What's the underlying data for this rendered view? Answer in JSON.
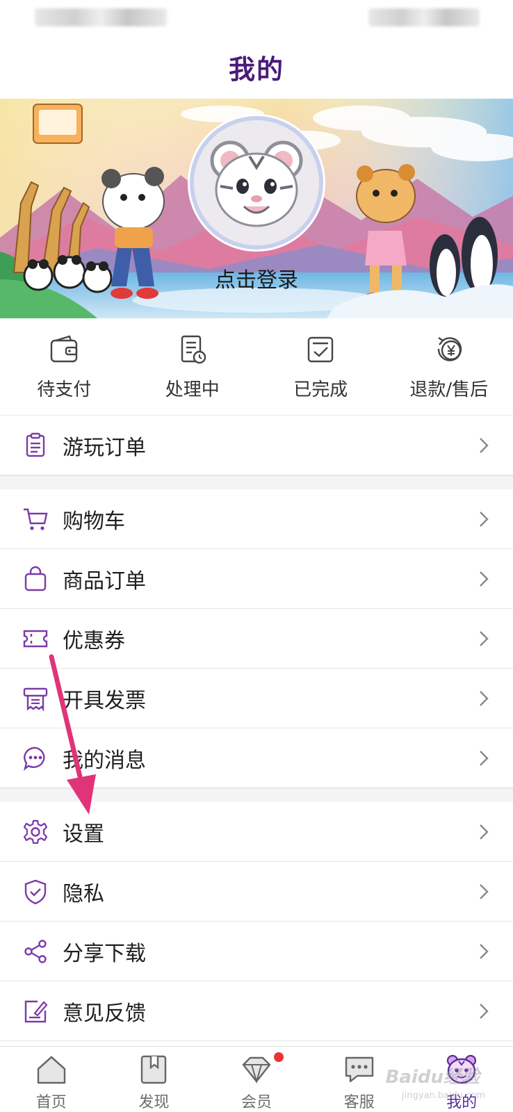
{
  "header": {
    "title": "我的"
  },
  "profile": {
    "login_label": "点击登录"
  },
  "orders": [
    {
      "label": "待支付",
      "icon": "wallet-icon"
    },
    {
      "label": "处理中",
      "icon": "document-clock-icon"
    },
    {
      "label": "已完成",
      "icon": "check-box-icon"
    },
    {
      "label": "退款/售后",
      "icon": "refund-yen-icon"
    }
  ],
  "menu": {
    "group1": [
      {
        "label": "游玩订单",
        "icon": "clipboard-icon"
      }
    ],
    "group2": [
      {
        "label": "购物车",
        "icon": "cart-icon"
      },
      {
        "label": "商品订单",
        "icon": "shopping-bag-icon"
      },
      {
        "label": "优惠券",
        "icon": "ticket-icon"
      },
      {
        "label": "开具发票",
        "icon": "invoice-printer-icon"
      },
      {
        "label": "我的消息",
        "icon": "chat-bubble-icon"
      }
    ],
    "group3": [
      {
        "label": "设置",
        "icon": "gear-icon"
      },
      {
        "label": "隐私",
        "icon": "shield-icon"
      },
      {
        "label": "分享下载",
        "icon": "share-icon"
      },
      {
        "label": "意见反馈",
        "icon": "feedback-icon"
      }
    ]
  },
  "tabbar": [
    {
      "label": "首页",
      "icon": "home-icon"
    },
    {
      "label": "发现",
      "icon": "bookmark-icon"
    },
    {
      "label": "会员",
      "icon": "diamond-icon",
      "badge": true
    },
    {
      "label": "客服",
      "icon": "message-icon"
    },
    {
      "label": "我的",
      "icon": "tiger-face-icon",
      "active": true
    }
  ],
  "watermark": {
    "text": "Baidu经验",
    "sub": "jingyan.baidu.com"
  },
  "colors": {
    "accent": "#5b2aa0",
    "title": "#4b1a7a",
    "annotation_arrow": "#e0347a",
    "badge": "#ea3434"
  }
}
